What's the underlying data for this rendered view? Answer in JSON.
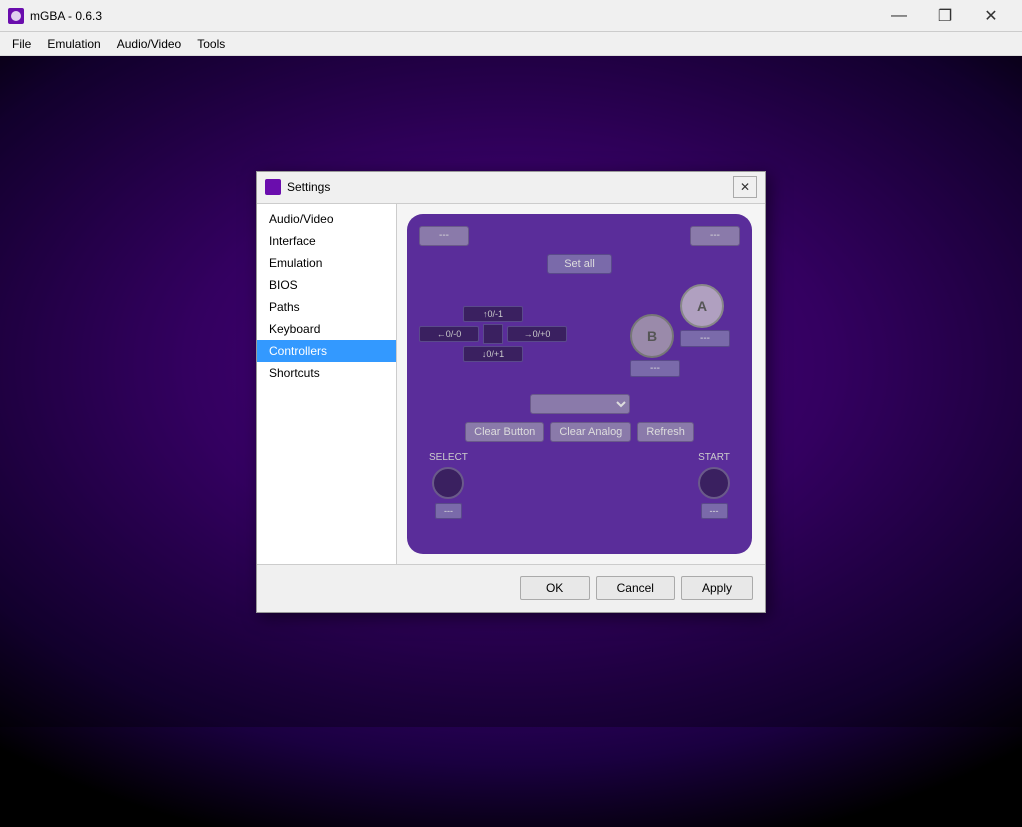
{
  "app": {
    "title": "mGBA - 0.6.3",
    "icon_color": "#6a0dad"
  },
  "titlebar": {
    "minimize": "—",
    "maximize": "❐",
    "close": "✕"
  },
  "menubar": {
    "items": [
      "File",
      "Emulation",
      "Audio/Video",
      "Tools"
    ]
  },
  "dialog": {
    "title": "Settings",
    "close_btn": "✕"
  },
  "sidebar": {
    "items": [
      {
        "label": "Audio/Video",
        "id": "audio-video"
      },
      {
        "label": "Interface",
        "id": "interface"
      },
      {
        "label": "Emulation",
        "id": "emulation"
      },
      {
        "label": "BIOS",
        "id": "bios"
      },
      {
        "label": "Paths",
        "id": "paths"
      },
      {
        "label": "Keyboard",
        "id": "keyboard"
      },
      {
        "label": "Controllers",
        "id": "controllers",
        "active": true
      },
      {
        "label": "Shortcuts",
        "id": "shortcuts"
      }
    ]
  },
  "controller": {
    "top_left_btn": "---",
    "top_right_btn": "---",
    "set_all_btn": "Set all",
    "dpad": {
      "up": "↑0/-1",
      "left": "←0/-0",
      "right": "→0/+0",
      "down": "↓0/+1"
    },
    "btn_a_label": "A",
    "btn_b_label": "B",
    "btn_a_under": "---",
    "btn_b_under": "---",
    "dropdown_placeholder": "",
    "clear_button": "Clear Button",
    "clear_analog": "Clear Analog",
    "refresh": "Refresh",
    "select_label": "SELECT",
    "start_label": "START",
    "select_btn": "---",
    "start_btn": "---"
  },
  "footer": {
    "ok": "OK",
    "cancel": "Cancel",
    "apply": "Apply"
  }
}
